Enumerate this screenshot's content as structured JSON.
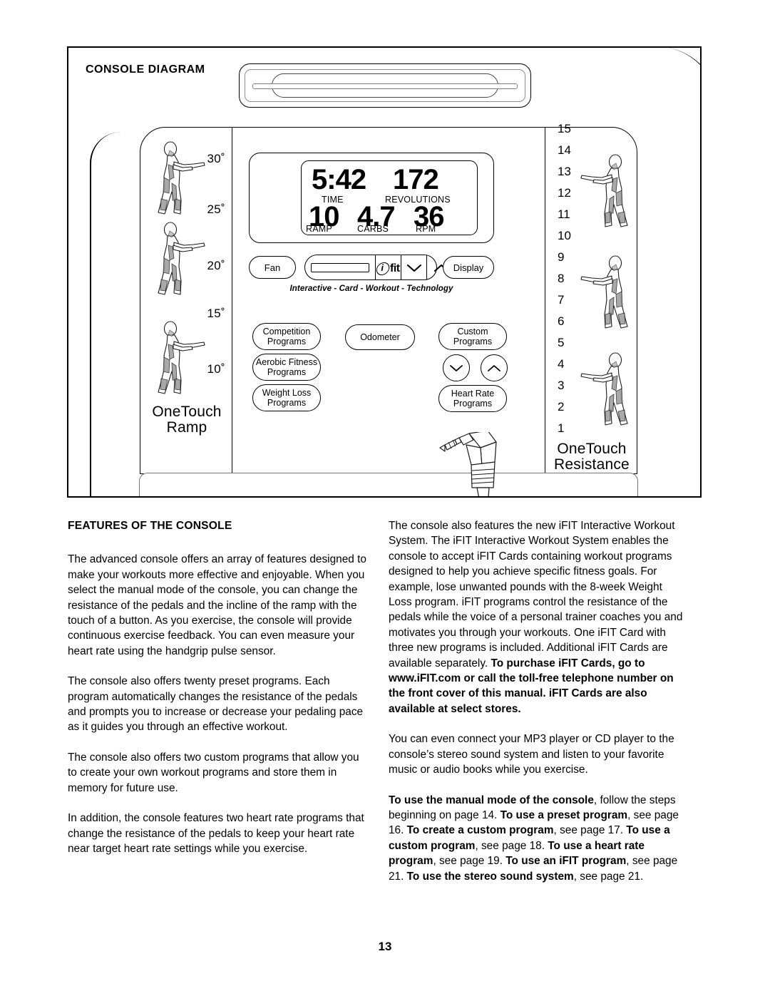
{
  "diagram": {
    "title": "CONSOLE DIAGRAM",
    "display": {
      "time_value": "5:42",
      "time_label": "TIME",
      "revolutions_value": "172",
      "revolutions_label": "REVOLUTIONS",
      "ramp_value": "10",
      "ramp_label": "RAMP",
      "carbs_value": "4.7",
      "carbs_label": "CARBS",
      "rpm_value": "36",
      "rpm_label": "RPM"
    },
    "ifit_row": {
      "fan_label": "Fan",
      "display_label": "Display",
      "logo_text": "fit",
      "tagline": "Interactive - Card - Workout - Technology"
    },
    "buttons": {
      "competition": "Competition Programs",
      "competition_l1": "Competition",
      "competition_l2": "Programs",
      "aerobic_l1": "Aerobic Fitness",
      "aerobic_l2": "Programs",
      "weightloss_l1": "Weight Loss",
      "weightloss_l2": "Programs",
      "odometer": "Odometer",
      "custom_l1": "Custom",
      "custom_l2": "Programs",
      "heartrate_l1": "Heart Rate",
      "heartrate_l2": "Programs"
    },
    "ramp_column": {
      "labels": [
        "30˚",
        "25˚",
        "20˚",
        "15˚",
        "10˚"
      ],
      "caption_l1": "OneTouch",
      "caption_l2": "Ramp"
    },
    "resistance_column": {
      "labels": [
        "15",
        "14",
        "13",
        "12",
        "11",
        "10",
        "9",
        "8",
        "7",
        "6",
        "5",
        "4",
        "3",
        "2",
        "1"
      ],
      "caption_l1": "OneTouch",
      "caption_l2": "Resistance"
    }
  },
  "content": {
    "section_heading": "FEATURES OF THE CONSOLE",
    "left_paragraphs": [
      "The advanced console offers an array of features designed to make your workouts more effective and enjoyable. When you select the manual mode of the console, you can change the resistance of the pedals and the incline of the ramp with the touch of a button. As you exercise, the console will provide continuous exercise feedback. You can even measure your heart rate using the handgrip pulse sensor.",
      "The console also offers twenty preset programs. Each program automatically changes the resistance of the pedals and prompts you to increase or decrease your pedaling pace as it guides you through an effective workout.",
      "The console also offers two custom programs that allow you to create your own workout programs and store them in memory for future use.",
      "In addition, the console features two heart rate programs that change the resistance of the pedals to keep your heart rate near target heart rate settings while you exercise."
    ],
    "right_p1_normal": "The console also features the new iFIT Interactive Workout System. The iFIT Interactive Workout System enables the console to accept iFIT Cards containing workout programs designed to help you achieve specific fitness goals. For example, lose unwanted pounds with the 8-week Weight Loss program. iFIT programs control the resistance of the pedals while the voice of a personal trainer coaches you and motivates you through your workouts. One iFIT Card with three new programs is included. Additional iFIT Cards are available separately. ",
    "right_p1_bold": "To purchase iFIT Cards, go to www.iFIT.com or call the toll-free telephone number on the front cover of this manual. iFIT Cards are also available at select stores.",
    "right_p2": "You can even connect your MP3 player or CD player to the console’s stereo sound system and listen to your favorite music or audio books while you exercise.",
    "right_p3_parts": [
      {
        "bold": true,
        "text": "To use the manual mode of the console"
      },
      {
        "bold": false,
        "text": ", follow the steps beginning on page 14. "
      },
      {
        "bold": true,
        "text": "To use a preset program"
      },
      {
        "bold": false,
        "text": ", see page 16. "
      },
      {
        "bold": true,
        "text": "To create a custom program"
      },
      {
        "bold": false,
        "text": ", see page 17. "
      },
      {
        "bold": true,
        "text": "To use a custom program"
      },
      {
        "bold": false,
        "text": ", see page 18. "
      },
      {
        "bold": true,
        "text": "To use a heart rate program"
      },
      {
        "bold": false,
        "text": ", see page 19. "
      },
      {
        "bold": true,
        "text": "To use an iFIT program"
      },
      {
        "bold": false,
        "text": ", see page 21. "
      },
      {
        "bold": true,
        "text": "To use the stereo sound system"
      },
      {
        "bold": false,
        "text": ", see page 21."
      }
    ]
  },
  "footer": {
    "page_number": "13"
  }
}
